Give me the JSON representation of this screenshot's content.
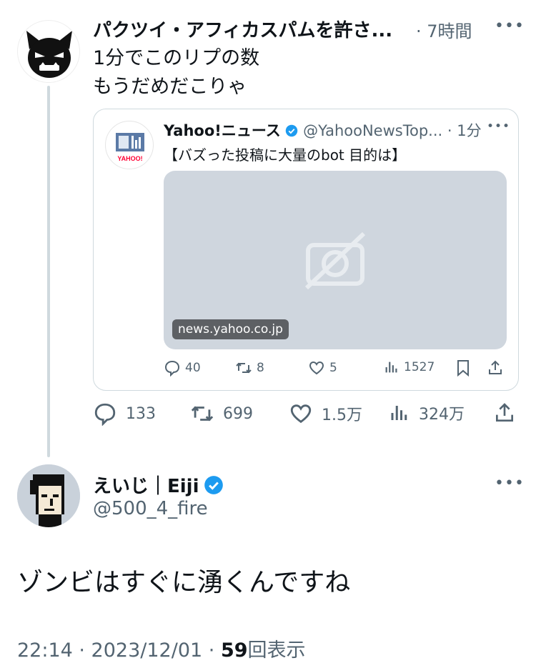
{
  "tweet1": {
    "display_name": "パクツイ・アフィカスパムを許さ...",
    "time": "· 7時間",
    "text": "1分でこのリプの数\nもうだめだこりゃ",
    "quote": {
      "display_name": "Yahoo!ニュース",
      "handle": "@YahooNewsTop...",
      "time": "· 1分",
      "text": "【バズった投稿に大量のbot 目的は】",
      "link_domain": "news.yahoo.co.jp",
      "avatar_logo_text": "YAHOO!",
      "actions": {
        "replies": "40",
        "retweets": "8",
        "likes": "5",
        "views": "1527"
      }
    },
    "actions": {
      "replies": "133",
      "retweets": "699",
      "likes": "1.5万",
      "views": "324万"
    }
  },
  "tweet2": {
    "display_name": "えいじ｜Eiji",
    "handle": "@500_4_fire",
    "text": "ゾンビはすぐに湧くんですね",
    "time": "22:14 · 2023/12/01 · ",
    "view_count": "59",
    "view_label": "回表示"
  },
  "colors": {
    "verified": "#1d9bf0",
    "muted": "#536471",
    "text": "#0f1419",
    "border": "#cfd9de"
  }
}
